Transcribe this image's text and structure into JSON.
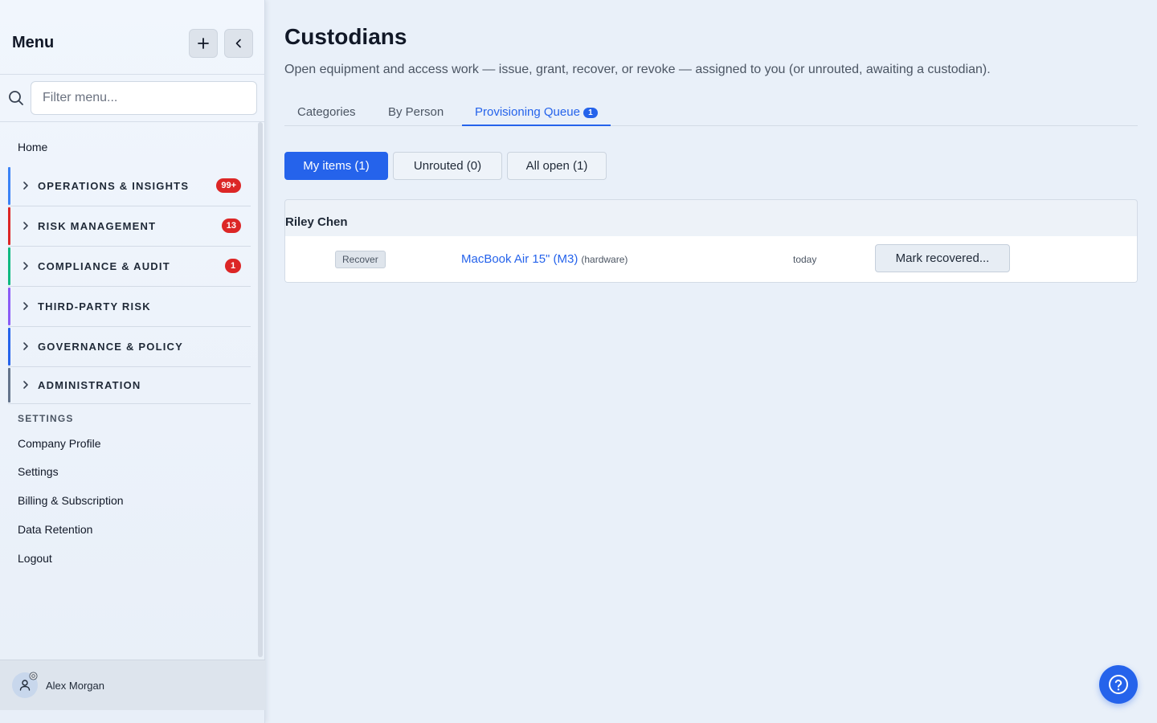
{
  "sidebar": {
    "title": "Menu",
    "search": {
      "placeholder": "Filter menu..."
    },
    "home_label": "Home",
    "groups": [
      {
        "label": "OPERATIONS & INSIGHTS",
        "badge": "99+",
        "color": "#3b82f6"
      },
      {
        "label": "RISK MANAGEMENT",
        "badge": "13",
        "color": "#dc2626"
      },
      {
        "label": "COMPLIANCE & AUDIT",
        "badge": "1",
        "color": "#10b981"
      },
      {
        "label": "THIRD-PARTY RISK",
        "badge": "",
        "color": "#8b5cf6"
      },
      {
        "label": "GOVERNANCE & POLICY",
        "badge": "",
        "color": "#2563eb"
      },
      {
        "label": "ADMINISTRATION",
        "badge": "",
        "color": "#64748b"
      }
    ],
    "settings": {
      "heading": "SETTINGS",
      "items": [
        "Company Profile",
        "Settings",
        "Billing & Subscription",
        "Data Retention",
        "Logout"
      ]
    },
    "user": {
      "name": "Alex Morgan"
    }
  },
  "main": {
    "title": "Custodians",
    "description": "Open equipment and access work — issue, grant, recover, or revoke — assigned to you (or unrouted, awaiting a custodian).",
    "tabs": [
      {
        "label": "Categories"
      },
      {
        "label": "By Person"
      },
      {
        "label": "Provisioning Queue",
        "badge": "1",
        "active": true
      }
    ],
    "filters": [
      {
        "label": "My items (1)",
        "active": true
      },
      {
        "label": "Unrouted (0)"
      },
      {
        "label": "All open (1)"
      }
    ],
    "groups": [
      {
        "person": "Riley Chen",
        "items": [
          {
            "action": "Recover",
            "asset": "MacBook Air 15\" (M3)",
            "asset_type": "(hardware)",
            "date": "today",
            "button": "Mark recovered..."
          }
        ]
      }
    ]
  },
  "colors": {
    "accent": "#2563eb",
    "danger_badge": "#dc2626"
  }
}
